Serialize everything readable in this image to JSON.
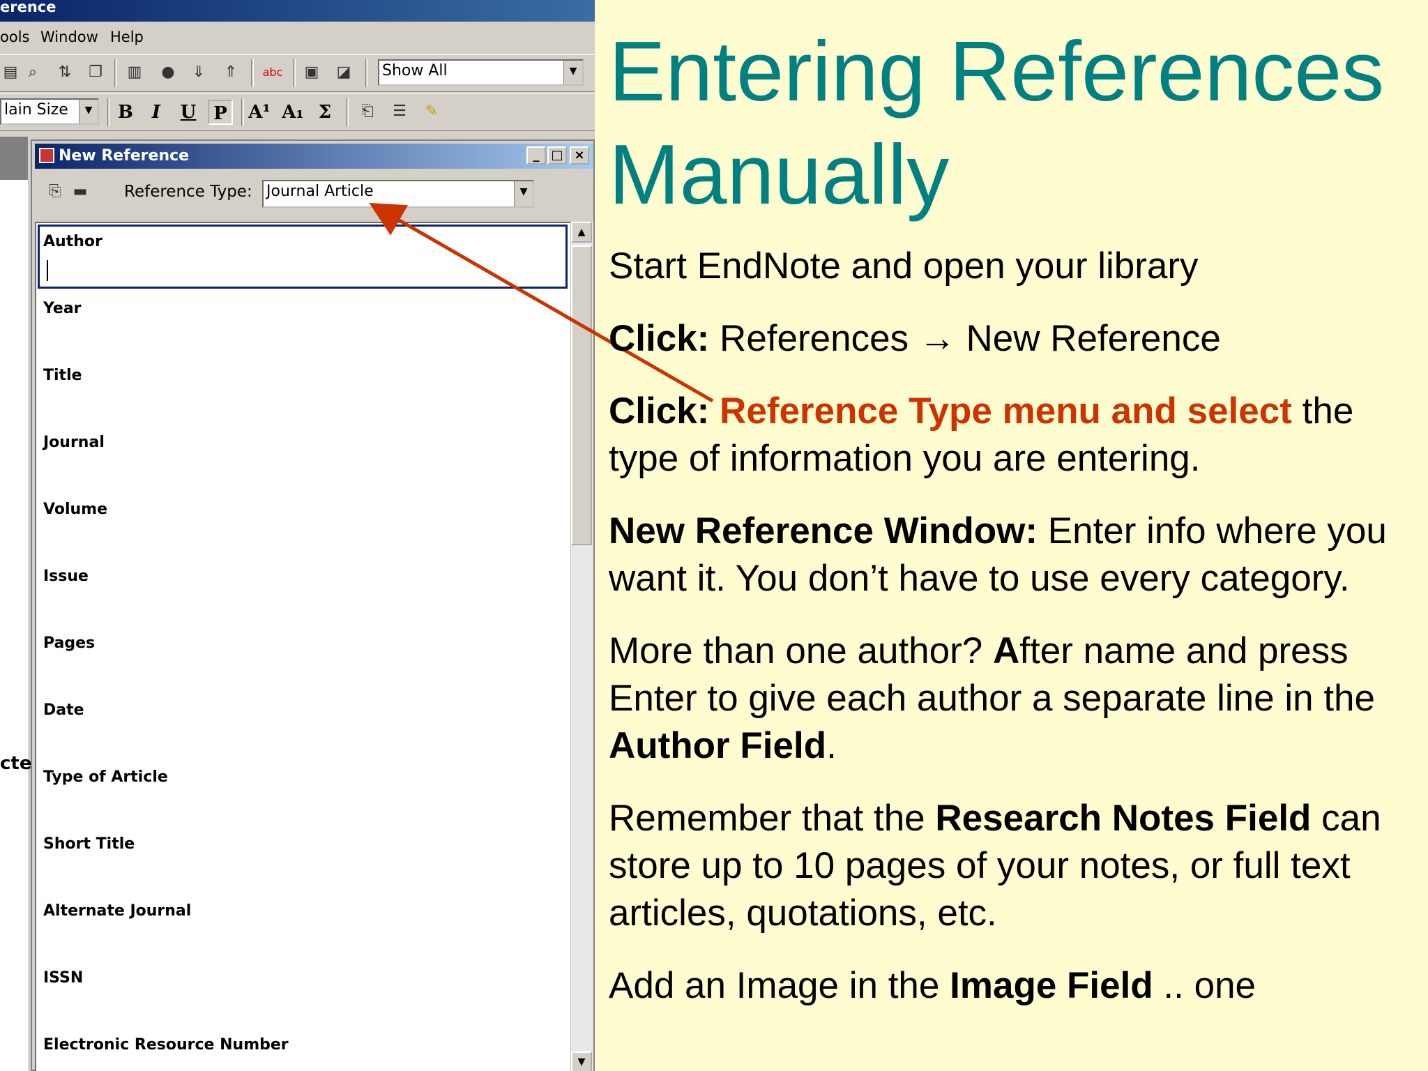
{
  "app": {
    "title_fragment": "erence",
    "menu": [
      "ools",
      "Window",
      "Help"
    ],
    "show_combo": "Show All",
    "size_combo": "lain Size",
    "format_buttons": [
      "B",
      "I",
      "U",
      "P",
      "A¹",
      "A₁",
      "Σ"
    ]
  },
  "left_strip": {
    "text": "cte"
  },
  "window": {
    "title": "New Reference",
    "controls": [
      "_",
      "□",
      "×"
    ],
    "reftype_label": "Reference Type:",
    "reftype_value": "Journal Article",
    "fields": [
      "Author",
      "Year",
      "Title",
      "Journal",
      "Volume",
      "Issue",
      "Pages",
      "Date",
      "Type of Article",
      "Short Title",
      "Alternate Journal",
      "ISSN",
      "Electronic Resource Number"
    ]
  },
  "slide": {
    "title_line1": "Entering References",
    "title_line2": "Manually",
    "b1": "Start EndNote and open your library",
    "b2_bold": "Click:",
    "b2_text": " References → New Reference",
    "b3_bold": "Click:",
    "b3_red": " Reference Type menu and select",
    "b3_text": " the type of information you are entering.",
    "b4_bold": "New Reference Window:",
    "b4_text": " Enter info where you want it. You don’t have to use every category.",
    "b5_text1": "More than one author? ",
    "b5_bold1": "A",
    "b5_text2": "fter name and press Enter to give each author a separate line in the ",
    "b5_bold2": "Author Field",
    "b5_text3": ".",
    "b6_text1": "Remember that the ",
    "b6_bold": "Research Notes Field",
    "b6_text2": " can store up to 10 pages of your notes, or full text articles, quotations, etc.",
    "b7_text1": "Add an Image in the ",
    "b7_bold": "Image Field",
    "b7_text2": " .. one"
  },
  "colors": {
    "title": "#008080",
    "highlight": "#cc3300",
    "background": "#fffccf",
    "arrow": "#cc3300"
  }
}
